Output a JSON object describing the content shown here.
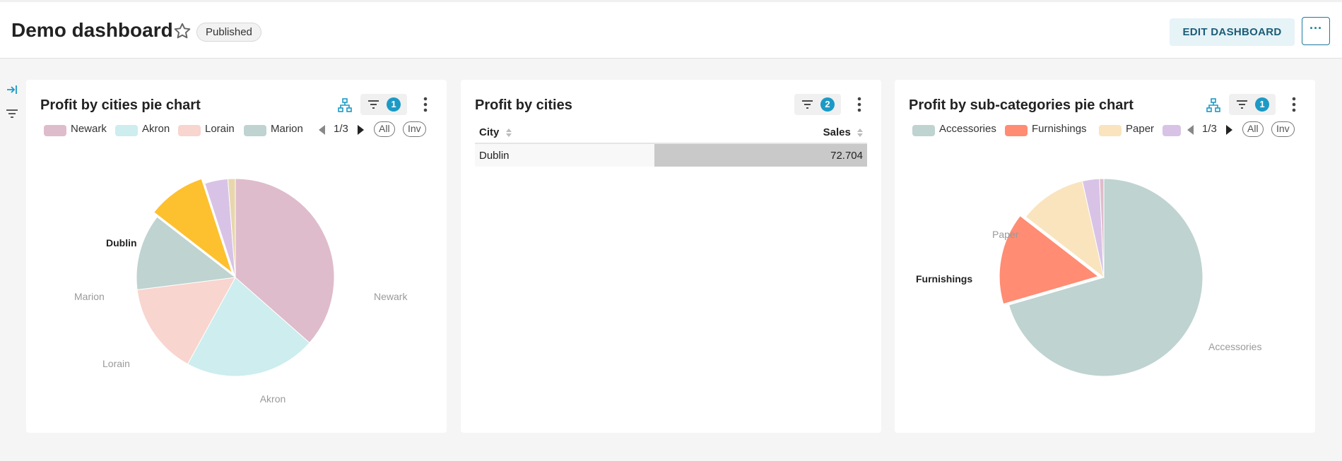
{
  "header": {
    "title": "Demo dashboard",
    "status_badge": "Published",
    "edit_label": "EDIT DASHBOARD",
    "more_label": "···"
  },
  "charts": {
    "cities_pie": {
      "title": "Profit by cities pie chart",
      "filter_count": "1",
      "legend": [
        "Newark",
        "Akron",
        "Lorain",
        "Marion"
      ],
      "page": "1/3",
      "all_label": "All",
      "inv_label": "Inv"
    },
    "cities_table": {
      "title": "Profit by cities",
      "filter_count": "2",
      "columns": [
        "City",
        "Sales"
      ],
      "rows": [
        {
          "city": "Dublin",
          "sales": "72.704"
        }
      ]
    },
    "subcat_pie": {
      "title": "Profit by sub-categories pie chart",
      "filter_count": "1",
      "legend": [
        "Accessories",
        "Furnishings",
        "Paper"
      ],
      "page": "1/3",
      "all_label": "All",
      "inv_label": "Inv"
    }
  },
  "chart_data": [
    {
      "type": "pie",
      "title": "Profit by cities pie chart",
      "highlighted": "Dublin",
      "slices": [
        {
          "label": "Newark",
          "value": 36.5,
          "color": "#dfbccb"
        },
        {
          "label": "Akron",
          "value": 21.5,
          "color": "#cdedef"
        },
        {
          "label": "Lorain",
          "value": 15.0,
          "color": "#f8d5ce"
        },
        {
          "label": "Marion",
          "value": 12.5,
          "color": "#bfd3d1"
        },
        {
          "label": "Dublin",
          "value": 9.5,
          "color": "#fdc02f"
        },
        {
          "label": "",
          "value": 3.8,
          "color": "#d8c3e6"
        },
        {
          "label": "",
          "value": 1.2,
          "color": "#e8d6ad"
        }
      ]
    },
    {
      "type": "table",
      "title": "Profit by cities",
      "columns": [
        "City",
        "Sales"
      ],
      "rows": [
        [
          "Dublin",
          72.704
        ]
      ]
    },
    {
      "type": "pie",
      "title": "Profit by sub-categories pie chart",
      "highlighted": "Furnishings",
      "slices": [
        {
          "label": "Accessories",
          "value": 70.5,
          "color": "#bfd3d1"
        },
        {
          "label": "Furnishings",
          "value": 15.0,
          "color": "#ff8c73"
        },
        {
          "label": "Paper",
          "value": 11.0,
          "color": "#f9e4be"
        },
        {
          "label": "",
          "value": 2.8,
          "color": "#d8c3e6"
        },
        {
          "label": "",
          "value": 0.7,
          "color": "#dfbccb"
        }
      ]
    }
  ],
  "colors": {
    "accent": "#1c9ac6",
    "edit_bg": "#e6f3f7",
    "edit_text": "#1b5d77"
  }
}
